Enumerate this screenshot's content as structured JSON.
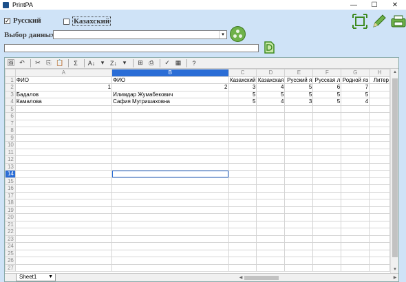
{
  "window": {
    "title": "PrintPA",
    "minimize": "—",
    "maximize": "☐",
    "close": "✕"
  },
  "options": {
    "russian_label": "Русский",
    "russian_checked": "✓",
    "kazakh_label": "Казахский",
    "kazakh_checked": ""
  },
  "data_select": {
    "label": "Выбор данных",
    "value": "",
    "arrow": "▾"
  },
  "path_input": {
    "value": ""
  },
  "toolbar_icons": [
    "fit-icon",
    "pencil-icon",
    "print-icon"
  ],
  "sheet": {
    "toolbar": [
      "🖼",
      "↶",
      "✂",
      "⎘",
      "📋",
      "Σ",
      "A↓",
      "▾",
      "Z↓",
      "▾",
      "⊞",
      "⎙",
      "✓",
      "▦",
      "?"
    ],
    "columns": [
      "",
      "A",
      "B",
      "C",
      "D",
      "E",
      "F",
      "G",
      "H"
    ],
    "selected_column": "B",
    "selected_row": 14,
    "rows": [
      [
        "1",
        "ФИО",
        "ФИО",
        "Казахский",
        "Казахская",
        "Русский я",
        "Русская л",
        "Родной яз",
        "Литер"
      ],
      [
        "2",
        "1",
        "2",
        "3",
        "4",
        "5",
        "6",
        "7",
        ""
      ],
      [
        "3",
        "Бадалов",
        "Илимдар Жумабекович",
        "5",
        "5",
        "5",
        "5",
        "5",
        ""
      ],
      [
        "4",
        "Камалова",
        "Сафия Мугришаховна",
        "5",
        "4",
        "3",
        "5",
        "4",
        ""
      ],
      [
        "5",
        "",
        "",
        "",
        "",
        "",
        "",
        "",
        ""
      ],
      [
        "6",
        "",
        "",
        "",
        "",
        "",
        "",
        "",
        ""
      ],
      [
        "7",
        "",
        "",
        "",
        "",
        "",
        "",
        "",
        ""
      ],
      [
        "8",
        "",
        "",
        "",
        "",
        "",
        "",
        "",
        ""
      ],
      [
        "9",
        "",
        "",
        "",
        "",
        "",
        "",
        "",
        ""
      ],
      [
        "10",
        "",
        "",
        "",
        "",
        "",
        "",
        "",
        ""
      ],
      [
        "11",
        "",
        "",
        "",
        "",
        "",
        "",
        "",
        ""
      ],
      [
        "12",
        "",
        "",
        "",
        "",
        "",
        "",
        "",
        ""
      ],
      [
        "13",
        "",
        "",
        "",
        "",
        "",
        "",
        "",
        ""
      ],
      [
        "14",
        "",
        "",
        "",
        "",
        "",
        "",
        "",
        ""
      ],
      [
        "15",
        "",
        "",
        "",
        "",
        "",
        "",
        "",
        ""
      ],
      [
        "16",
        "",
        "",
        "",
        "",
        "",
        "",
        "",
        ""
      ],
      [
        "17",
        "",
        "",
        "",
        "",
        "",
        "",
        "",
        ""
      ],
      [
        "18",
        "",
        "",
        "",
        "",
        "",
        "",
        "",
        ""
      ],
      [
        "19",
        "",
        "",
        "",
        "",
        "",
        "",
        "",
        ""
      ],
      [
        "20",
        "",
        "",
        "",
        "",
        "",
        "",
        "",
        ""
      ],
      [
        "21",
        "",
        "",
        "",
        "",
        "",
        "",
        "",
        ""
      ],
      [
        "22",
        "",
        "",
        "",
        "",
        "",
        "",
        "",
        ""
      ],
      [
        "23",
        "",
        "",
        "",
        "",
        "",
        "",
        "",
        ""
      ],
      [
        "24",
        "",
        "",
        "",
        "",
        "",
        "",
        "",
        ""
      ],
      [
        "25",
        "",
        "",
        "",
        "",
        "",
        "",
        "",
        ""
      ],
      [
        "26",
        "",
        "",
        "",
        "",
        "",
        "",
        "",
        ""
      ],
      [
        "27",
        "",
        "",
        "",
        "",
        "",
        "",
        "",
        ""
      ]
    ],
    "tab_name": "Sheet1",
    "tab_arrow": "▼",
    "scroll_up": "▲",
    "scroll_down": "▼",
    "scroll_left": "◀",
    "scroll_right": "▶"
  },
  "colors": {
    "background": "#cfe3f7",
    "selection": "#2a6dd6",
    "icon_green": "#6fb24a"
  }
}
